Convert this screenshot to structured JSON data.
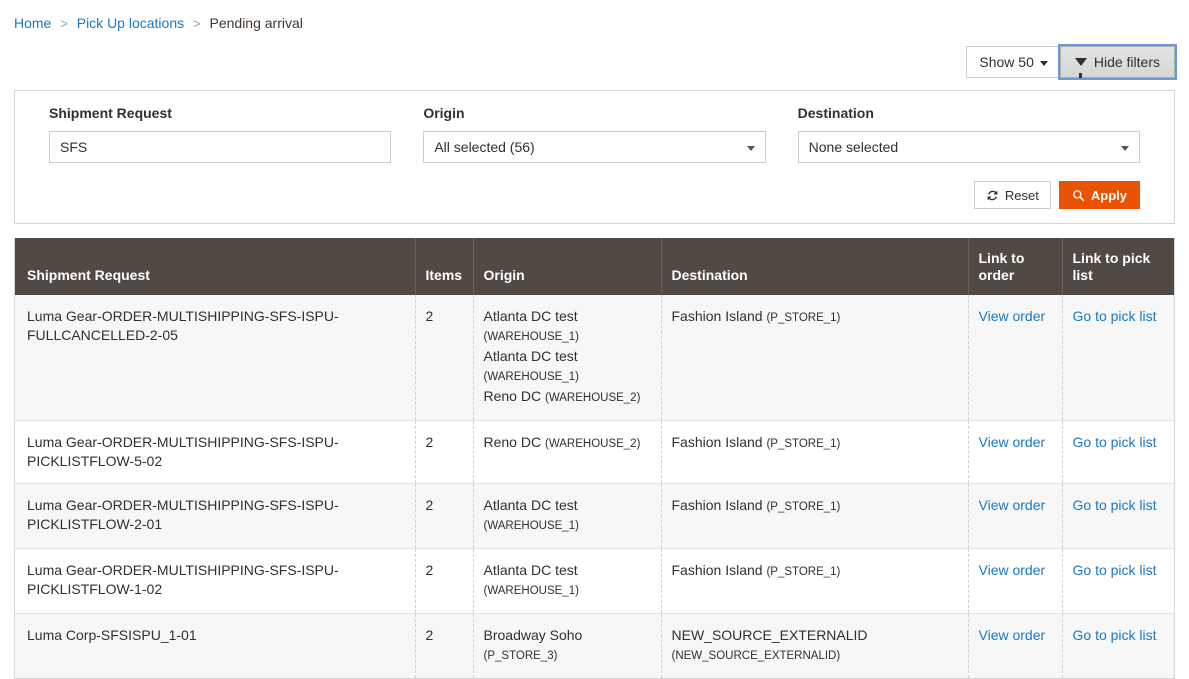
{
  "breadcrumb": {
    "items": [
      {
        "label": "Home",
        "link": true
      },
      {
        "label": "Pick Up locations",
        "link": true
      },
      {
        "label": "Pending arrival",
        "link": false
      }
    ],
    "separator": ">"
  },
  "toolbar": {
    "show_label": "Show 50",
    "hide_filters_label": "Hide filters",
    "focus_ring_color": "#699ad7"
  },
  "filters": {
    "shipment_request": {
      "label": "Shipment Request",
      "value": "SFS",
      "placeholder": ""
    },
    "origin": {
      "label": "Origin",
      "value": "All selected (56)"
    },
    "destination": {
      "label": "Destination",
      "value": "None selected"
    },
    "reset_label": "Reset",
    "apply_label": "Apply",
    "apply_color": "#eb5202"
  },
  "table": {
    "header_color": "#514943",
    "columns": [
      "Shipment Request",
      "Items",
      "Origin",
      "Destination",
      "Link to order",
      "Link to pick list"
    ],
    "rows": [
      {
        "shipment_request": "Luma Gear-ORDER-MULTISHIPPING-SFS-ISPU-FULLCANCELLED-2-05",
        "items": "2",
        "origin": [
          {
            "name": "Atlanta DC test",
            "code": "(WAREHOUSE_1)"
          },
          {
            "name": "Atlanta DC test",
            "code": "(WAREHOUSE_1)"
          },
          {
            "name": "Reno DC",
            "code": "(WAREHOUSE_2)"
          }
        ],
        "destination": [
          {
            "name": "Fashion Island",
            "code": "(P_STORE_1)"
          }
        ],
        "link_order": "View order",
        "link_pick_list": "Go to pick list"
      },
      {
        "shipment_request": "Luma Gear-ORDER-MULTISHIPPING-SFS-ISPU-PICKLISTFLOW-5-02",
        "items": "2",
        "origin": [
          {
            "name": "Reno DC",
            "code": "(WAREHOUSE_2)"
          }
        ],
        "destination": [
          {
            "name": "Fashion Island",
            "code": "(P_STORE_1)"
          }
        ],
        "link_order": "View order",
        "link_pick_list": "Go to pick list"
      },
      {
        "shipment_request": "Luma Gear-ORDER-MULTISHIPPING-SFS-ISPU-PICKLISTFLOW-2-01",
        "items": "2",
        "origin": [
          {
            "name": "Atlanta DC test",
            "code": "(WAREHOUSE_1)"
          }
        ],
        "destination": [
          {
            "name": "Fashion Island",
            "code": "(P_STORE_1)"
          }
        ],
        "link_order": "View order",
        "link_pick_list": "Go to pick list"
      },
      {
        "shipment_request": "Luma Gear-ORDER-MULTISHIPPING-SFS-ISPU-PICKLISTFLOW-1-02",
        "items": "2",
        "origin": [
          {
            "name": "Atlanta DC test",
            "code": "(WAREHOUSE_1)"
          }
        ],
        "destination": [
          {
            "name": "Fashion Island",
            "code": "(P_STORE_1)"
          }
        ],
        "link_order": "View order",
        "link_pick_list": "Go to pick list"
      },
      {
        "shipment_request": "Luma Corp-SFSISPU_1-01",
        "items": "2",
        "origin": [
          {
            "name": "Broadway Soho",
            "code": "(P_STORE_3)"
          }
        ],
        "destination": [
          {
            "name": "NEW_SOURCE_EXTERNALID",
            "code": "(NEW_SOURCE_EXTERNALID)"
          }
        ],
        "link_order": "View order",
        "link_pick_list": "Go to pick list"
      }
    ]
  }
}
